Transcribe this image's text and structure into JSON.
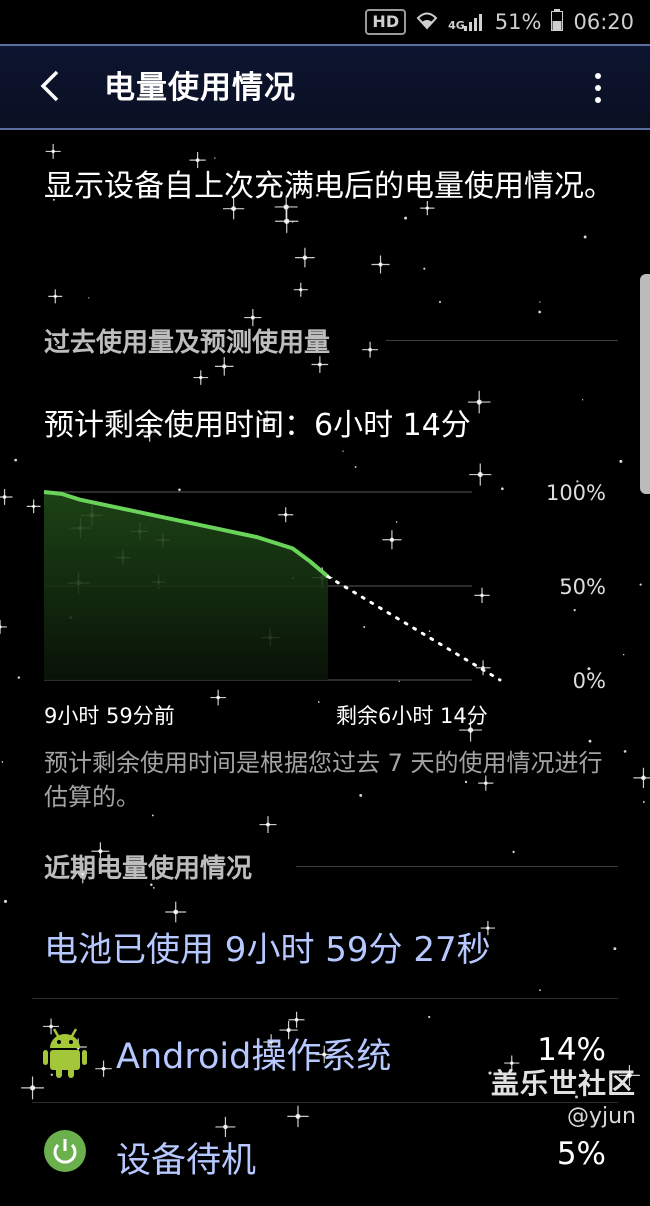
{
  "status_bar": {
    "hd": "HD",
    "network": "4G",
    "battery": "51%",
    "time": "06:20"
  },
  "header": {
    "title": "电量使用情况"
  },
  "description": "显示设备自上次充满电后的电量使用情况。",
  "section_past": {
    "title": "过去使用量及预测使用量"
  },
  "estimate": {
    "text": "预计剩余使用时间：6小时 14分"
  },
  "chart_data": {
    "type": "line",
    "y_ticks": [
      "100%",
      "50%",
      "0%"
    ],
    "ylim": [
      0,
      100
    ],
    "x_start_label": "9小时 59分前",
    "x_end_label": "剩余6小时 14分",
    "series": [
      {
        "values": [
          100,
          99,
          96,
          94,
          92,
          90,
          88,
          86,
          84,
          82,
          80,
          78,
          76,
          73,
          70,
          63,
          55
        ]
      },
      {
        "values": [
          55,
          0
        ]
      }
    ],
    "colors": {
      "actual": "#6ad45a",
      "predicted": "#ffffff",
      "grid": "#3a3a3a"
    }
  },
  "note": "预计剩余使用时间是根据您过去 7 天的使用情况进行估算的。",
  "section_recent": {
    "title": "近期电量使用情况"
  },
  "battery_used": "电池已使用 9小时 59分 27秒",
  "apps": [
    {
      "name": "Android操作系统",
      "percent": "14%",
      "icon": "android-icon"
    },
    {
      "name": "设备待机",
      "percent": "5%",
      "icon": "power-icon"
    }
  ],
  "watermark": {
    "site": "盖乐世社区",
    "user": "@yjun"
  },
  "colors": {
    "accent_text": "#b6c8ff",
    "android_green": "#a4c639",
    "header_border": "#5a6fa0"
  }
}
